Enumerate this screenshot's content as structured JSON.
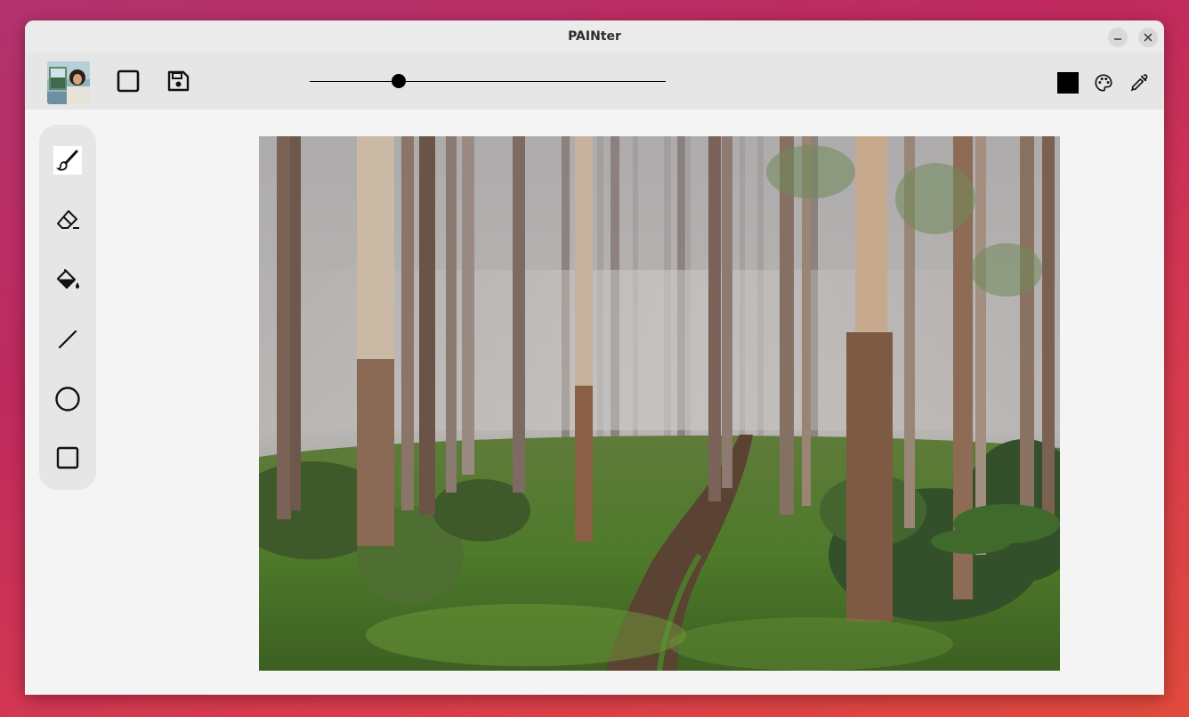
{
  "window": {
    "title": "PAINter",
    "minimize_icon": "minimize-icon",
    "close_icon": "close-icon"
  },
  "toolbar": {
    "avatar_icon": "avatar-image",
    "new_canvas_icon": "square-outline-icon",
    "save_icon": "floppy-disk-icon",
    "brush_size_fraction": 0.25,
    "current_color": "#000000",
    "palette_icon": "palette-icon",
    "eyedropper_icon": "eyedropper-icon"
  },
  "tools": [
    {
      "name": "brush",
      "icon": "paintbrush-icon",
      "active": true
    },
    {
      "name": "eraser",
      "icon": "eraser-icon",
      "active": false
    },
    {
      "name": "fill",
      "icon": "paint-bucket-icon",
      "active": false
    },
    {
      "name": "line",
      "icon": "line-icon",
      "active": false
    },
    {
      "name": "ellipse",
      "icon": "circle-icon",
      "active": false
    },
    {
      "name": "rectangle",
      "icon": "rectangle-icon",
      "active": false
    }
  ],
  "canvas": {
    "image": "misty-forest-photo"
  }
}
